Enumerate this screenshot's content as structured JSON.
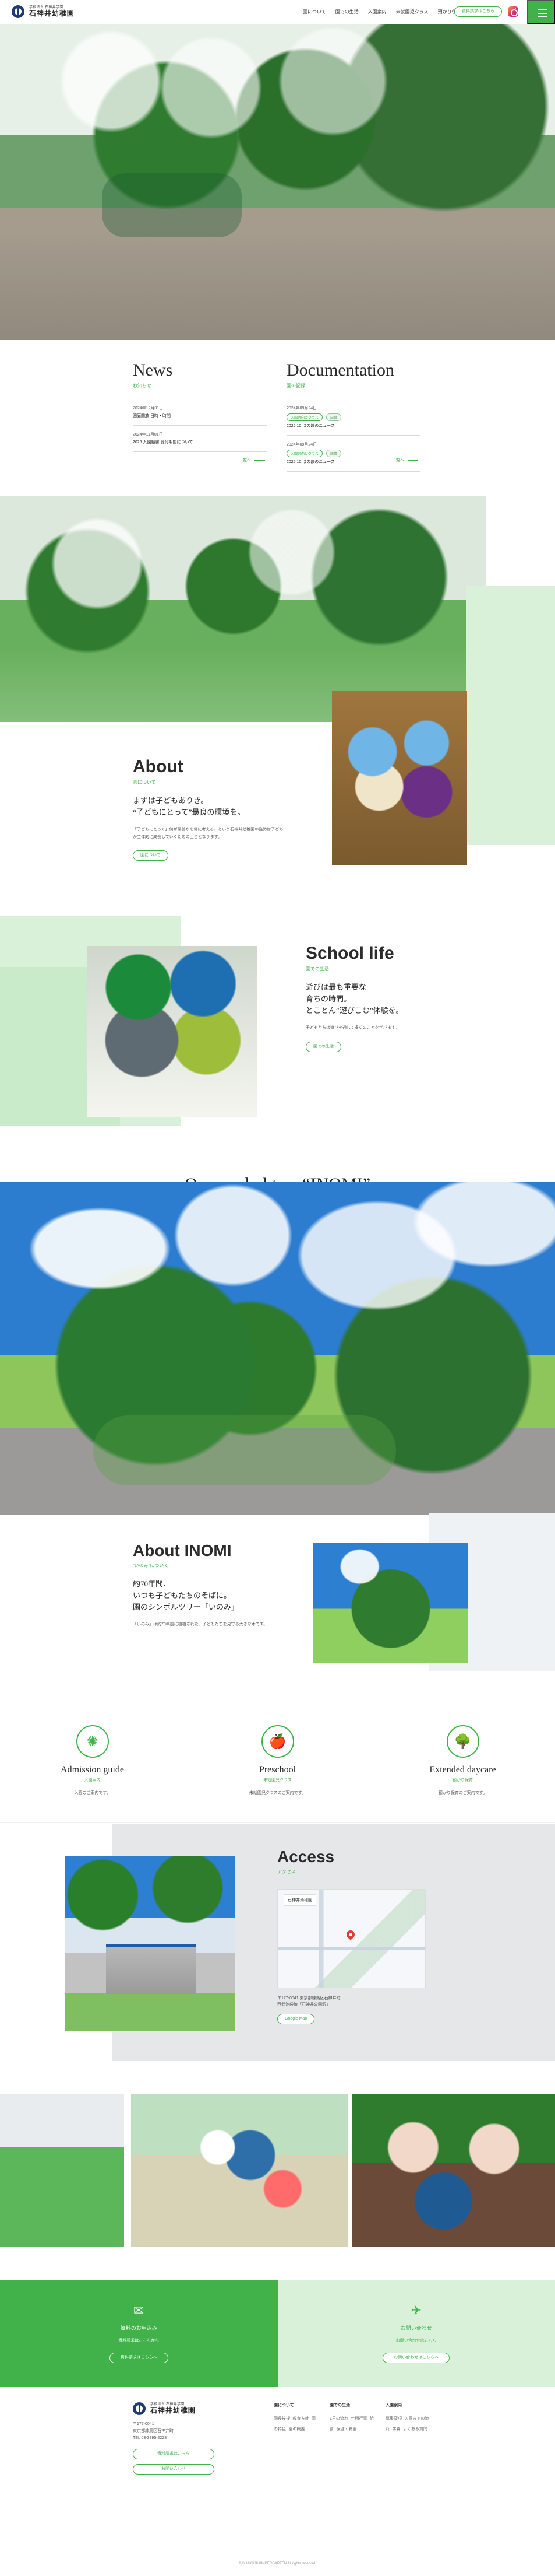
{
  "header": {
    "logo_small": "学校法人 石神井学園",
    "logo_main": "石神井幼稚園",
    "nav": [
      "園について",
      "園での生活",
      "入園案内",
      "未就園児クラス",
      "預かり保育"
    ],
    "cta": "資料請求はこちら"
  },
  "news": {
    "title": "News",
    "subtitle": "お知らせ",
    "items": [
      {
        "date": "2024年12月01日",
        "title": "園庭開放 日時・時間"
      },
      {
        "date": "2024年11月01日",
        "title": "2025 入園願書 受付期間について"
      }
    ],
    "more": "一覧へ"
  },
  "documentation": {
    "title": "Documentation",
    "subtitle": "園の記録",
    "items": [
      {
        "date": "2024年09月24日",
        "chips": [
          "入園者向けクラス",
          "記事"
        ],
        "title": "2025.10.ほのぼのニュース"
      },
      {
        "date": "2024年09月24日",
        "chips": [
          "入園者向けクラス",
          "記事"
        ],
        "title": "2025.10.ほのぼのニュース"
      }
    ],
    "more": "一覧へ"
  },
  "about": {
    "title": "About",
    "subtitle": "園について",
    "lead": "まずは子どもありき。\n“子どもにとって”最良の環境を。",
    "desc": "「子どもにとって」何が最善かを常に考える、という石神井幼稚園の姿勢は子どもが主体的に成長していくための土台となります。",
    "button": "園について"
  },
  "school_life": {
    "title": "School life",
    "subtitle": "園での生活",
    "lead": "遊びは最も重要な\n育ちの時間。\nとことん“遊びこむ”体験を。",
    "desc": "子どもたちは遊びを通して多くのことを学びます。",
    "button": "園での生活"
  },
  "inomi": {
    "symbol_title": "Our symbol tree “INOMI”",
    "title": "About INOMI",
    "subtitle": "“いのみ”について",
    "lead": "約70年間、\nいつも子どもたちのそばに。\n園のシンボルツリー「いのみ」",
    "desc": "「いのみ」は約70年前に植樹された、子どもたちを見守る大きな木です。"
  },
  "features": [
    {
      "en": "Admission guide",
      "jp": "入園案内",
      "desc": "入園のご案内です。",
      "icon": "badge-icon"
    },
    {
      "en": "Preschool",
      "jp": "未就園児クラス",
      "desc": "未就園児クラスのご案内です。",
      "icon": "apple-icon"
    },
    {
      "en": "Extended daycare",
      "jp": "預かり保育",
      "desc": "預かり保育のご案内です。",
      "icon": "tree-icon"
    }
  ],
  "access": {
    "title": "Access",
    "subtitle": "アクセス",
    "map_label": "石神井幼稚園",
    "address": "〒177-0041 東京都練馬区石神井町",
    "route": "西武池袋線「石神井公園駅」",
    "map_button": "Google Map"
  },
  "cta": {
    "left": {
      "title": "資料のお申込み",
      "desc": "資料請求はこちらから",
      "button": "資料請求はこちらへ"
    },
    "right": {
      "title": "お問い合わせ",
      "desc": "お問い合わせはこちら",
      "button": "お問い合わせはこちらへ"
    }
  },
  "footer": {
    "address": "〒177-0041\n東京都練馬区石神井町\nTEL 03-3995-2228",
    "btn1": "資料請求はこちら",
    "btn2": "お問い合わせ",
    "cols": [
      {
        "head": "園について",
        "links": [
          "園長挨拶",
          "教育方針",
          "園の特色",
          "園の概要"
        ]
      },
      {
        "head": "園での生活",
        "links": [
          "1日の流れ",
          "年間行事",
          "給食",
          "保健・安全"
        ]
      },
      {
        "head": "入園案内",
        "links": [
          "募集要項",
          "入園までの流れ",
          "学費",
          "よくある質問"
        ]
      }
    ],
    "copyright": "© SHAKUJII KINDERGARTEN All rights reserved."
  }
}
